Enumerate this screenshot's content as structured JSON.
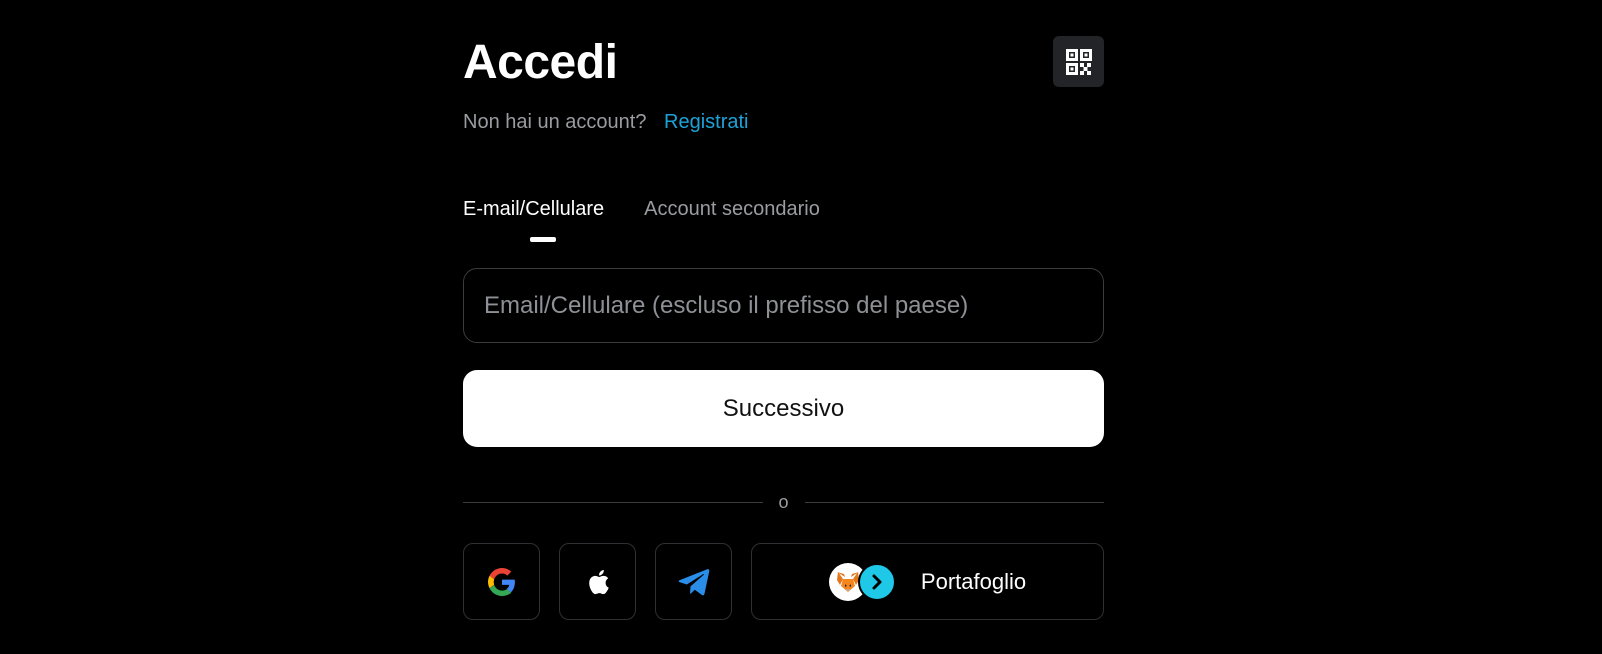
{
  "header": {
    "title": "Accedi",
    "qr_icon": "qr-code-icon"
  },
  "signup": {
    "prompt": "Non hai un account?",
    "link": "Registrati"
  },
  "tabs": [
    {
      "label": "E-mail/Cellulare",
      "active": true
    },
    {
      "label": "Account secondario",
      "active": false
    }
  ],
  "form": {
    "input_value": "",
    "input_placeholder": "Email/Cellulare (escluso il prefisso del paese)",
    "next_label": "Successivo"
  },
  "divider": {
    "text": "o"
  },
  "social": {
    "buttons": [
      {
        "icon": "google-icon"
      },
      {
        "icon": "apple-icon"
      },
      {
        "icon": "telegram-icon"
      }
    ],
    "wallet_label": "Portafoglio"
  },
  "colors": {
    "background": "#000000",
    "accent_link": "#1da2d8",
    "muted_text": "#9a9ca1",
    "border": "#3a3c40",
    "primary_button": "#ffffff"
  }
}
